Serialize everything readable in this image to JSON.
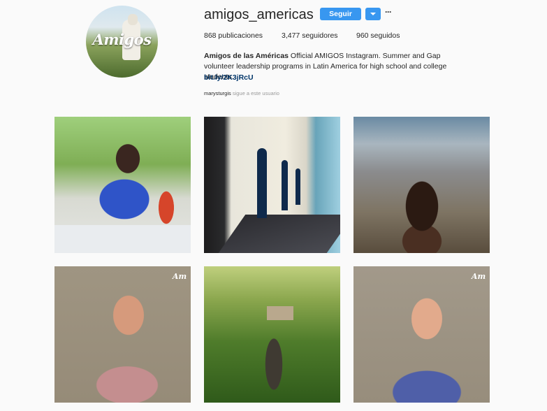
{
  "profile": {
    "username": "amigos_americas",
    "avatar_logo_text": "Amigos",
    "follow_label": "Seguir",
    "more_glyph": "···",
    "stats": {
      "posts": "868 publicaciones",
      "followers": "3,477 seguidores",
      "following": "960 seguidos"
    },
    "bio": {
      "name": "Amigos de las Américas",
      "text": " Official AMIGOS Instagram. Summer and Gap volunteer leadership programs in Latin America for high school and college students.",
      "link": "bit.ly/2K3jRcU"
    },
    "followed_by": {
      "user": "marysturgis",
      "text": " sigue a este usuario"
    }
  },
  "posts": [
    {
      "subject": "group-photo"
    },
    {
      "subject": "colonial-building-arches"
    },
    {
      "subject": "city-overlook-portrait"
    },
    {
      "subject": "video-portrait-bearded-man",
      "watermark": "Am"
    },
    {
      "subject": "hikers-on-trail"
    },
    {
      "subject": "video-portrait-man",
      "watermark": "Am"
    }
  ],
  "colors": {
    "accent": "#3897f0",
    "link": "#003569",
    "background": "#fafafa"
  }
}
